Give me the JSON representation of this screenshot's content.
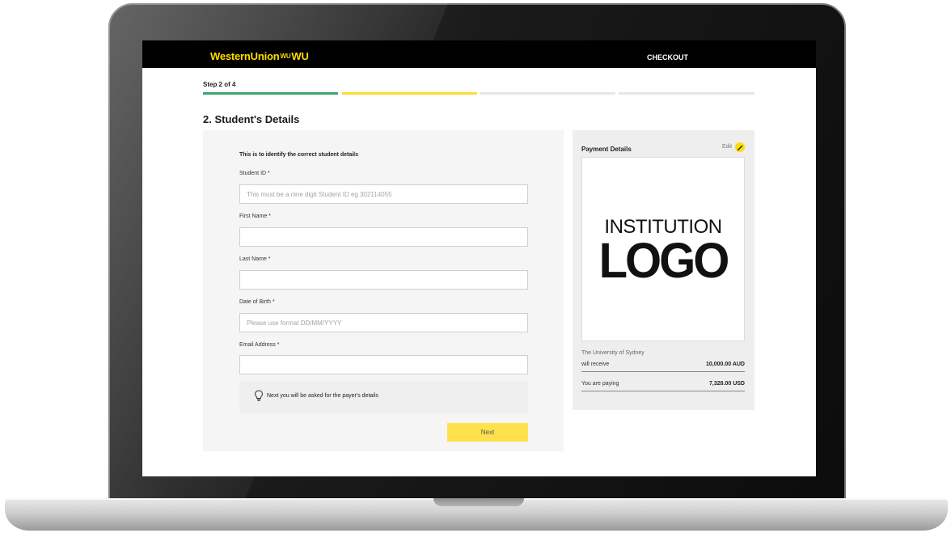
{
  "header": {
    "brand_text": "WesternUnion",
    "brand_mark": "WU",
    "brand_suffix": "WU",
    "checkout_label": "CHECKOUT"
  },
  "progress": {
    "step_label": "Step 2 of 4",
    "current_step": 2,
    "total_steps": 4,
    "colors": {
      "complete": "#3aa86b",
      "current": "#ffdd33",
      "pending": "#e6e6e6"
    }
  },
  "section_title": "2. Student's Details",
  "form": {
    "intro": "This is to identify the correct student details",
    "fields": {
      "student_id": {
        "label": "Student ID *",
        "placeholder": "This must be a nine digit Student ID eg 302114055",
        "value": ""
      },
      "first_name": {
        "label": "First Name *",
        "placeholder": "",
        "value": ""
      },
      "last_name": {
        "label": "Last Name *",
        "placeholder": "",
        "value": ""
      },
      "date_of_birth": {
        "label": "Date of Birth *",
        "placeholder": "Please use format DD/MM/YYYY",
        "value": ""
      },
      "email": {
        "label": "Email Address *",
        "placeholder": "",
        "value": ""
      }
    },
    "hint": "Next you will be asked for the payer's details",
    "hint_icon": "lightbulb-icon",
    "next_label": "Next"
  },
  "payment": {
    "title": "Payment Details",
    "edit_label": "Edit",
    "edit_icon": "pencil-icon",
    "logo_line1": "INSTITUTION",
    "logo_line2": "LOGO",
    "institution": "The University of Sydney",
    "receive_label": "will receive",
    "receive_amount": "10,000.00 AUD",
    "paying_label": "You are paying",
    "paying_amount": "7,328.00 USD"
  },
  "colors": {
    "brand_yellow": "#ffdd00",
    "button_yellow": "#ffe14d",
    "topbar": "#000000"
  }
}
